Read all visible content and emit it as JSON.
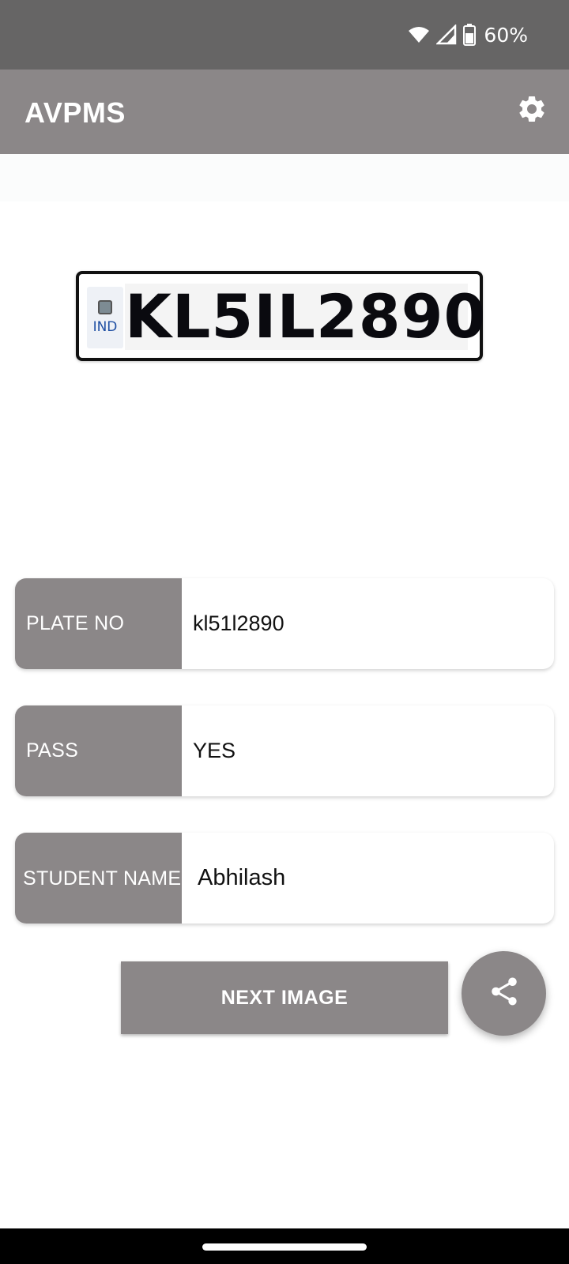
{
  "status_bar": {
    "battery_percent": "60%",
    "icons": [
      "wifi-icon",
      "cellular-signal-icon",
      "battery-icon"
    ]
  },
  "app_bar": {
    "title": "AVPMS",
    "settings_icon": "gear-icon"
  },
  "plate_image": {
    "country_code": "IND",
    "plate_text": "KL5IL2890"
  },
  "fields": {
    "plate_no": {
      "label": "PLATE NO",
      "value": "kl51l2890"
    },
    "pass": {
      "label": "PASS",
      "value": "YES"
    },
    "student_name": {
      "label": "STUDENT NAME",
      "value": "Abhilash"
    }
  },
  "actions": {
    "next_image_label": "NEXT IMAGE",
    "share_icon": "share-icon"
  },
  "colors": {
    "status_bar": "#666565",
    "accent": "#8b8788",
    "background": "#ffffff"
  }
}
